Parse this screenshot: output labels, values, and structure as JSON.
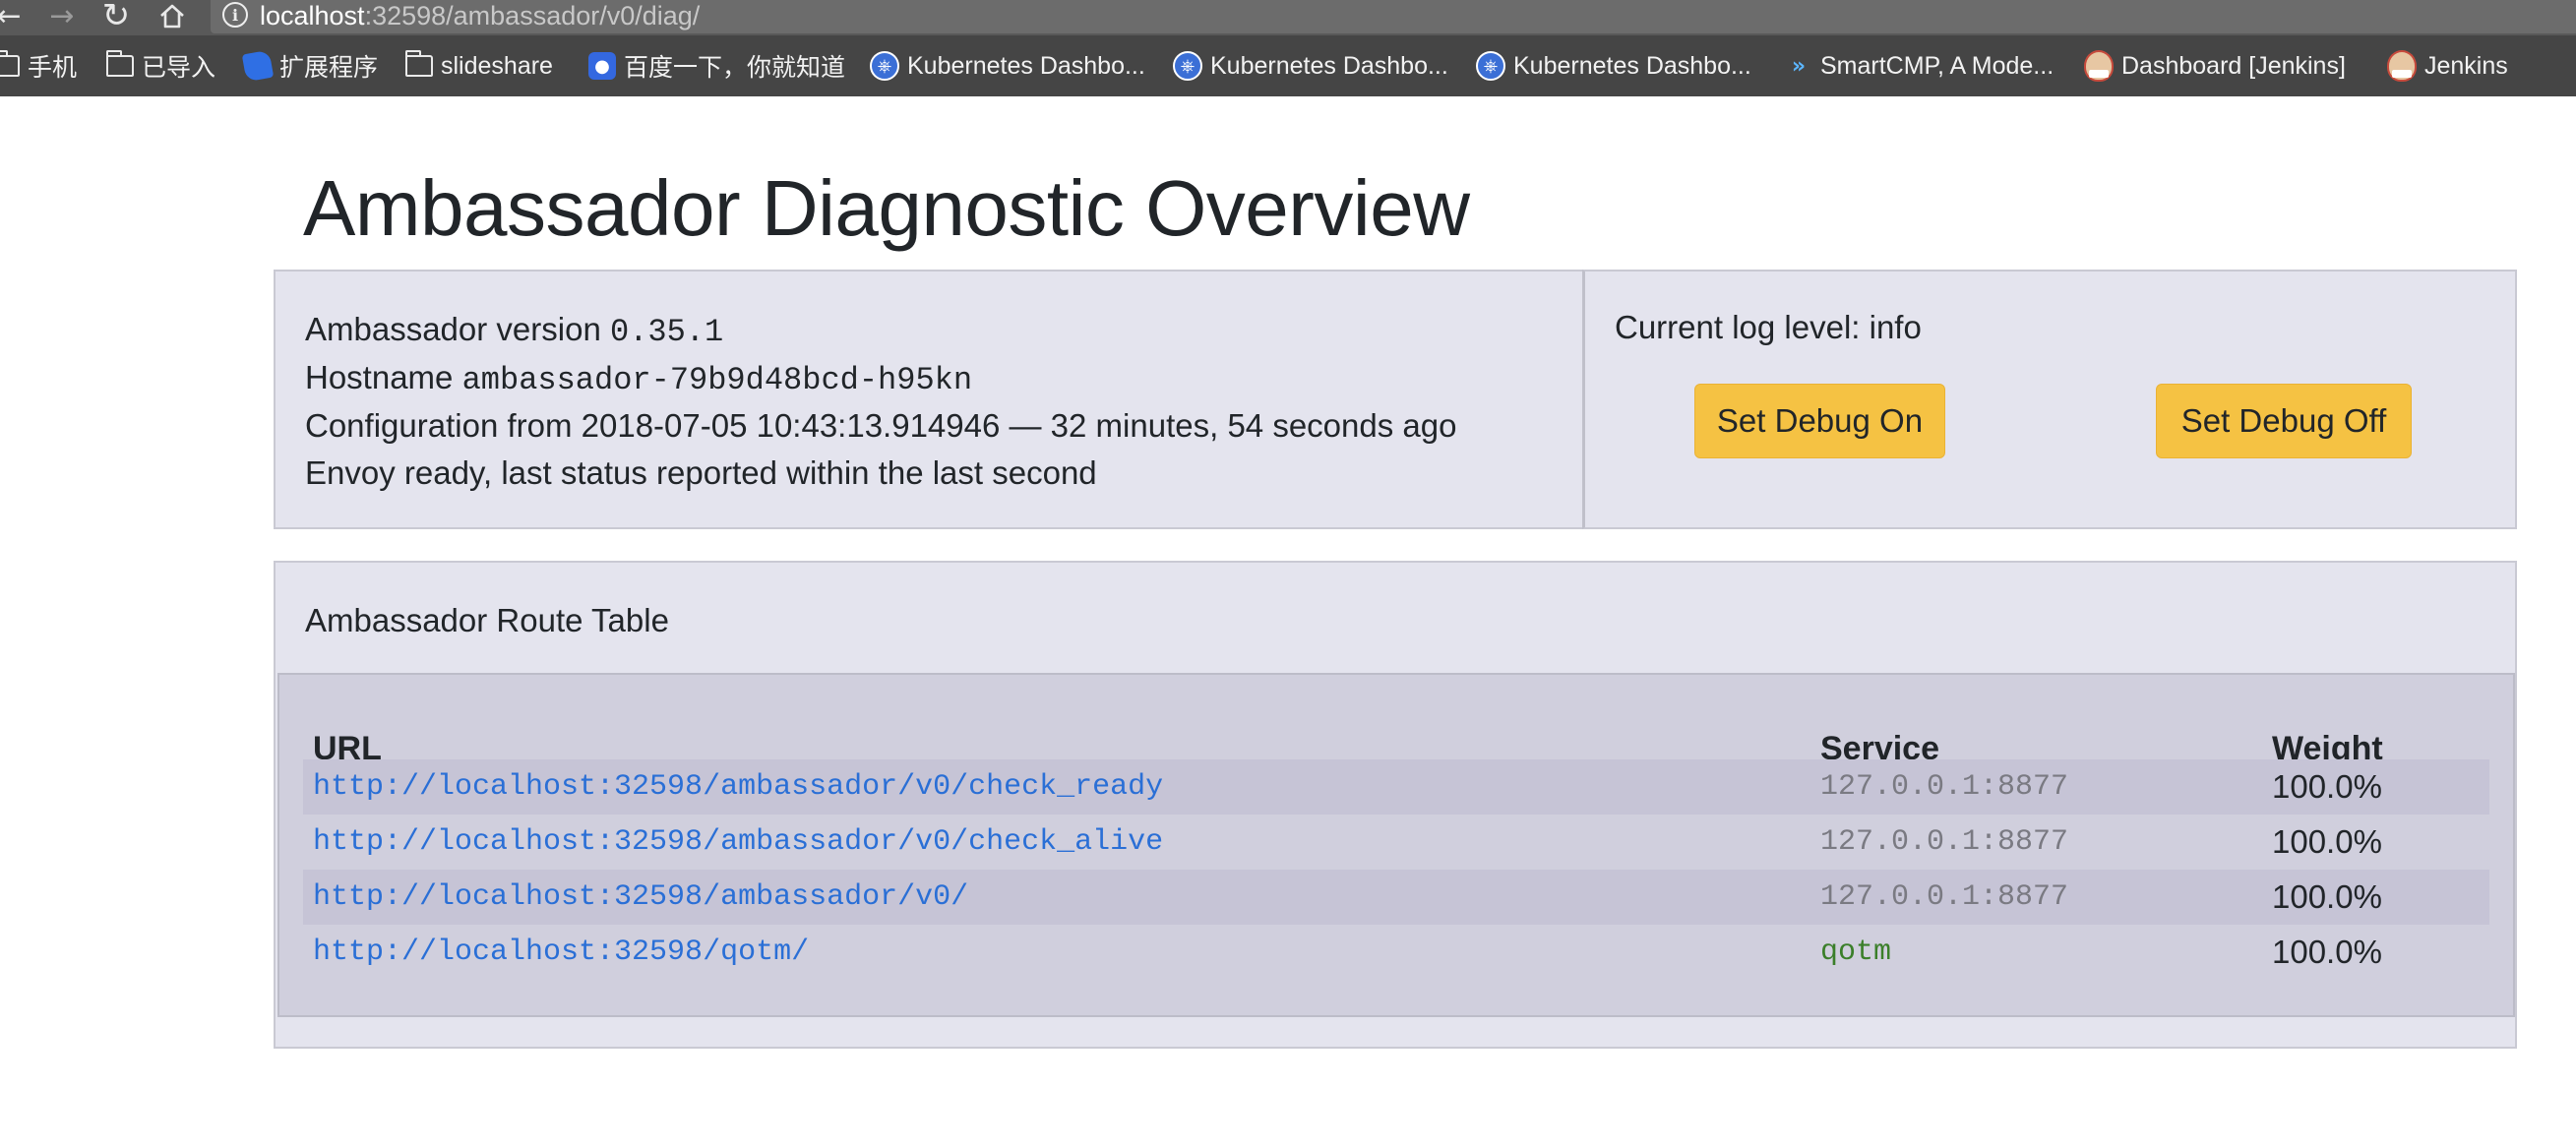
{
  "browser": {
    "url_host": "localhost",
    "url_path": ":32598/ambassador/v0/diag/"
  },
  "bookmarks": [
    {
      "label": "手机",
      "icon": "folder-icon"
    },
    {
      "label": "已导入",
      "icon": "folder-icon"
    },
    {
      "label": "扩展程序",
      "icon": "puzzle-icon"
    },
    {
      "label": "slideshare",
      "icon": "folder-icon"
    },
    {
      "label": "百度一下，你就知道",
      "icon": "baidu-paw-icon"
    },
    {
      "label": "Kubernetes Dashbo...",
      "icon": "kubernetes-icon"
    },
    {
      "label": "Kubernetes Dashbo...",
      "icon": "kubernetes-icon"
    },
    {
      "label": "Kubernetes Dashbo...",
      "icon": "kubernetes-icon"
    },
    {
      "label": "SmartCMP, A Mode...",
      "icon": "smartcmp-icon"
    },
    {
      "label": "Dashboard [Jenkins]",
      "icon": "jenkins-icon"
    },
    {
      "label": "Jenkins",
      "icon": "jenkins-icon"
    }
  ],
  "page": {
    "title": "Ambassador Diagnostic Overview"
  },
  "overview": {
    "version_label": "Ambassador version",
    "version_value": "0.35.1",
    "hostname_label": "Hostname",
    "hostname_value": "ambassador-79b9d48bcd-h95kn",
    "config_text": "Configuration from 2018-07-05 10:43:13.914946 — 32 minutes, 54 seconds ago",
    "envoy_text": "Envoy ready, last status reported within the last second"
  },
  "log": {
    "label": "Current log level: info",
    "debug_on_label": "Set Debug On",
    "debug_off_label": "Set Debug Off"
  },
  "route_table": {
    "heading": "Ambassador Route Table",
    "columns": {
      "url": "URL",
      "service": "Service",
      "weight": "Weight"
    },
    "rows": [
      {
        "url": "http://localhost:32598/ambassador/v0/check_ready",
        "service": "127.0.0.1:8877",
        "weight": "100.0%"
      },
      {
        "url": "http://localhost:32598/ambassador/v0/check_alive",
        "service": "127.0.0.1:8877",
        "weight": "100.0%"
      },
      {
        "url": "http://localhost:32598/ambassador/v0/",
        "service": "127.0.0.1:8877",
        "weight": "100.0%"
      },
      {
        "url": "http://localhost:32598/qotm/",
        "service": "qotm",
        "weight": "100.0%"
      }
    ]
  },
  "colors": {
    "button": "#f5c243",
    "link": "#2a6fd6",
    "service_internal": "#7a7a82",
    "service_user": "#3b7f2a",
    "panel_bg": "#e4e4ee"
  }
}
